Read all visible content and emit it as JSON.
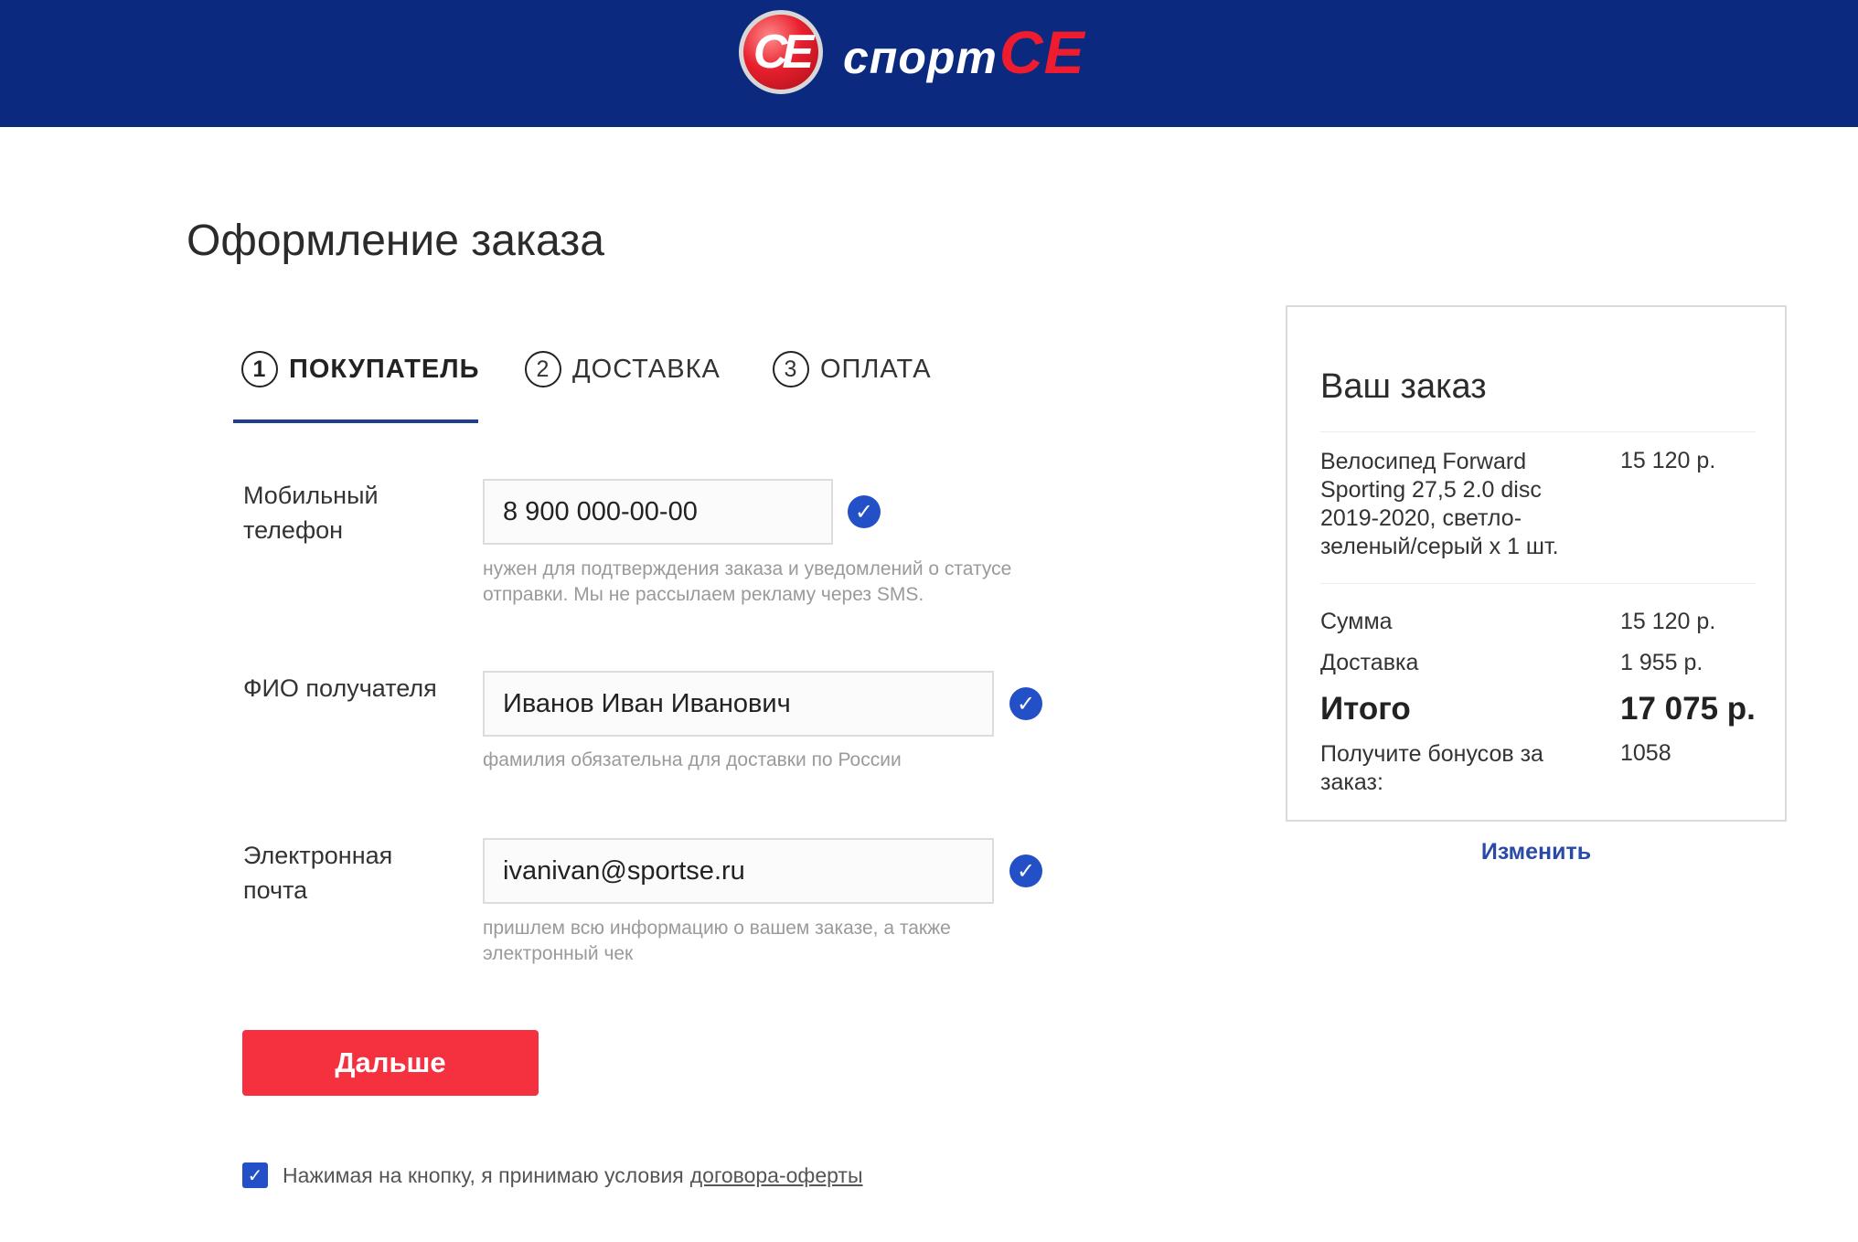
{
  "header": {
    "logo_mark": "СЕ",
    "logo_text": "спорт",
    "logo_accent": "СЕ"
  },
  "page": {
    "title": "Оформление заказа"
  },
  "steps": [
    {
      "number": "1",
      "label": "ПОКУПАТЕЛЬ",
      "active": true
    },
    {
      "number": "2",
      "label": "ДОСТАВКА",
      "active": false
    },
    {
      "number": "3",
      "label": "ОПЛАТА",
      "active": false
    }
  ],
  "form": {
    "phone": {
      "label_line1": "Мобильный",
      "label_line2": "телефон",
      "value": "8 900 000-00-00",
      "hint_line1": "нужен для подтверждения заказа и уведомлений о статусе",
      "hint_line2": "отправки. Мы не рассылаем рекламу через SMS."
    },
    "name": {
      "label": "ФИО получателя",
      "value": "Иванов Иван Иванович",
      "hint": "фамилия обязательна для доставки по России"
    },
    "email": {
      "label_line1": "Электронная",
      "label_line2": "почта",
      "value": "ivanivan@sportse.ru",
      "hint_line1": "пришлем всю информацию о вашем заказе, а также",
      "hint_line2": "электронный чек"
    },
    "next_label": "Дальше",
    "agree_text": "Нажимая на кнопку, я принимаю условия",
    "agree_link": "договора-оферты"
  },
  "order": {
    "title": "Ваш заказ",
    "product_line1": "Велосипед Forward",
    "product_line2": "Sporting 27,5 2.0 disc",
    "product_line3": "2019-2020, светло-",
    "product_line4": "зеленый/серый x 1 шт.",
    "product_price": "15 120 р.",
    "sum_label": "Сумма",
    "sum_value": "15 120 р.",
    "delivery_label": "Доставка",
    "delivery_value": "1 955 р.",
    "total_label": "Итого",
    "total_value": "17 075 р.",
    "bonus_line1": "Получите бонусов за",
    "bonus_line2": "заказ:",
    "bonus_value": "1058",
    "change_label": "Изменить"
  },
  "colors": {
    "header_bg": "#0b2a7f",
    "accent_red": "#f5303f",
    "check_blue": "#2450c7",
    "link_blue": "#2a4aa8"
  }
}
